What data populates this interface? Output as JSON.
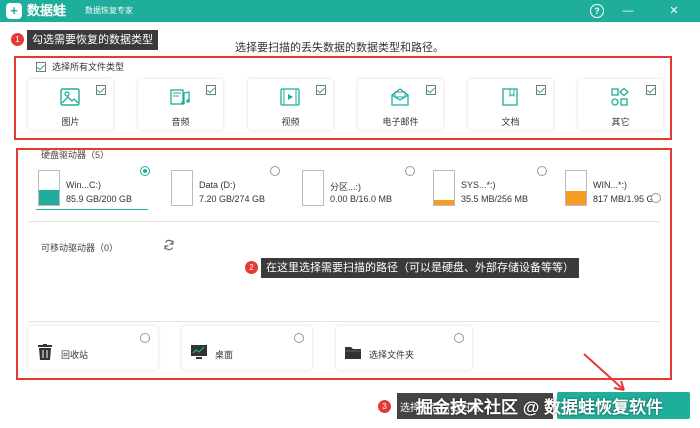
{
  "titlebar": {
    "logo_glyph": "+",
    "app_name": "数据蛙",
    "subtitle": "数据恢复专家",
    "help_glyph": "?",
    "minimize_glyph": "—",
    "close_glyph": "✕",
    "bg_color": "#1fae9b"
  },
  "annotations": {
    "step1": {
      "num": "1",
      "text": "勾选需要恢复的数据类型"
    },
    "step2": {
      "num": "2",
      "text": "在这里选择需要扫描的路径（可以是硬盘、外部存储设备等等）"
    },
    "step3": {
      "num": "3",
      "text": "选择好后点击扫描"
    },
    "badge_color": "#e53935",
    "box_color": "#e53935"
  },
  "page_heading": "选择要扫描的丢失数据的数据类型和路径。",
  "file_types": {
    "select_all_label": "选择所有文件类型",
    "select_all_checked": true,
    "items": [
      {
        "label": "图片",
        "icon": "image-icon",
        "checked": true
      },
      {
        "label": "音频",
        "icon": "music-icon",
        "checked": true
      },
      {
        "label": "视频",
        "icon": "video-icon",
        "checked": true
      },
      {
        "label": "电子邮件",
        "icon": "email-icon",
        "checked": true
      },
      {
        "label": "文档",
        "icon": "document-icon",
        "checked": true
      },
      {
        "label": "其它",
        "icon": "other-icon",
        "checked": true
      }
    ]
  },
  "hard_drives": {
    "title": "硬盘驱动器（5）",
    "items": [
      {
        "name": "Win...C:)",
        "size": "85.9 GB/200 GB",
        "selected": true,
        "fill_fraction": 0.43,
        "fill_color": "#1fae9b"
      },
      {
        "name": "Data (D:)",
        "size": "7.20 GB/274 GB",
        "selected": false,
        "fill_fraction": 0.0,
        "fill_color": "#1fae9b"
      },
      {
        "name": "分区...:)",
        "size": "0.00  B/16.0 MB",
        "selected": false,
        "fill_fraction": 0.0,
        "fill_color": "#f59a23"
      },
      {
        "name": "SYS...*:)",
        "size": "35.5 MB/256 MB",
        "selected": false,
        "fill_fraction": 0.14,
        "fill_color": "#f59a23"
      },
      {
        "name": "WIN...*:)",
        "size": "817 MB/1.95 GB",
        "selected": false,
        "fill_fraction": 0.42,
        "fill_color": "#f59a23"
      }
    ]
  },
  "removable": {
    "title": "可移动驱动器（0）",
    "refresh_icon": "refresh-icon"
  },
  "locations": [
    {
      "label": "回收站",
      "icon": "trash-icon"
    },
    {
      "label": "桌面",
      "icon": "desktop-icon"
    },
    {
      "label": "选择文件夹",
      "icon": "folder-icon"
    }
  ],
  "watermark": "掘金技术社区 @ 数据蛙恢复软件",
  "accent_color": "#1fae9b"
}
